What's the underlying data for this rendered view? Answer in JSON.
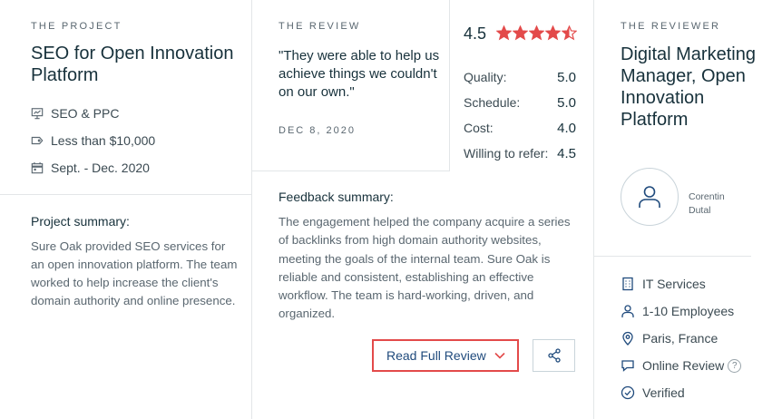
{
  "project": {
    "eyebrow": "THE PROJECT",
    "title": "SEO for Open Innovation Platform",
    "service": "SEO & PPC",
    "budget": "Less than $10,000",
    "dates": "Sept. - Dec. 2020",
    "summary_heading": "Project summary:",
    "summary_text": "Sure Oak provided SEO services for an open innovation platform. The team worked to help increase the client's domain authority and online presence."
  },
  "review": {
    "eyebrow": "THE REVIEW",
    "quote": "\"They were able to help us achieve things we couldn't on our own.\"",
    "date": "DEC 8, 2020",
    "overall": "4.5",
    "overall_value": 4.5,
    "star_color": "#e34a4a",
    "scores": [
      {
        "label": "Quality:",
        "value": "5.0"
      },
      {
        "label": "Schedule:",
        "value": "5.0"
      },
      {
        "label": "Cost:",
        "value": "4.0"
      },
      {
        "label": "Willing to refer:",
        "value": "4.5"
      }
    ],
    "feedback_heading": "Feedback summary:",
    "feedback_text": "The engagement helped the company acquire a series of backlinks from high domain authority websites, meeting the goals of the internal team. Sure Oak is reliable and consistent, establishing an effective workflow. The team is hard-working, driven, and organized.",
    "read_button": "Read Full Review",
    "accent_color": "#e34a4a"
  },
  "reviewer": {
    "eyebrow": "THE REVIEWER",
    "title": "Digital Marketing Manager, Open Innovation Platform",
    "name": "Corentin Dutal",
    "industry": "IT Services",
    "employees": "1-10 Employees",
    "location": "Paris, France",
    "review_type": "Online Review",
    "review_type_help": "?",
    "verified": "Verified"
  }
}
